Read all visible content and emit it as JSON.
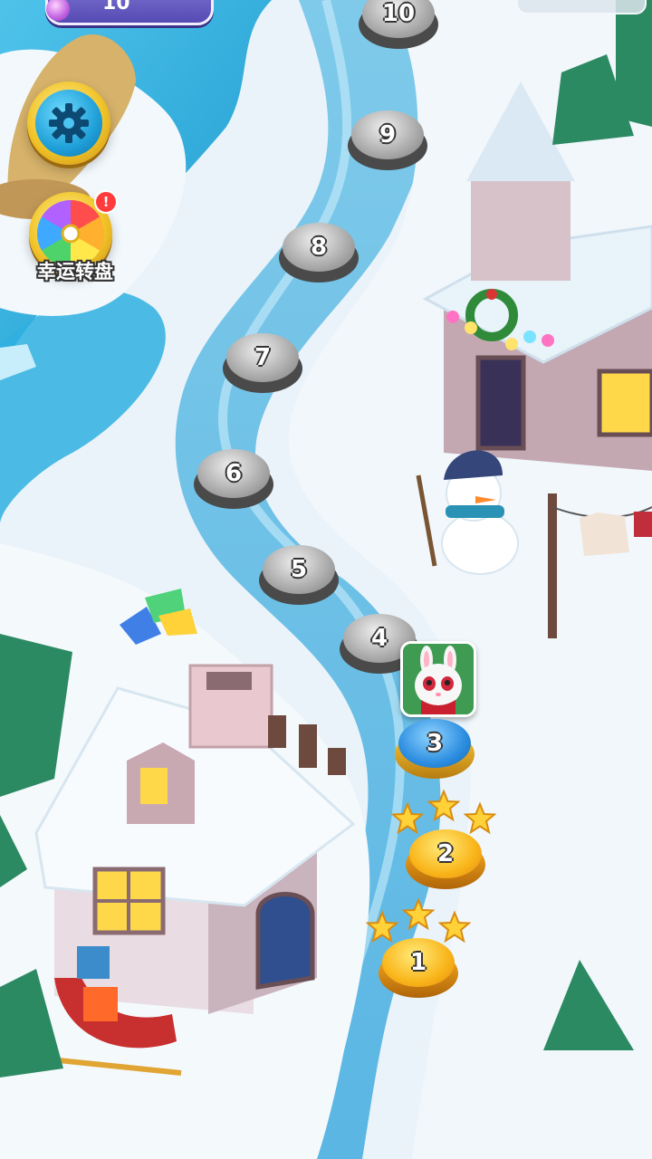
{
  "hud": {
    "gem_count": "10"
  },
  "side_buttons": {
    "wheel_label": "幸运转盘",
    "wheel_badge": "!"
  },
  "levels": [
    {
      "number": "1",
      "state": "done",
      "stars": 3
    },
    {
      "number": "2",
      "state": "done",
      "stars": 3
    },
    {
      "number": "3",
      "state": "current"
    },
    {
      "number": "4",
      "state": "locked"
    },
    {
      "number": "5",
      "state": "locked"
    },
    {
      "number": "6",
      "state": "locked"
    },
    {
      "number": "7",
      "state": "locked"
    },
    {
      "number": "8",
      "state": "locked"
    },
    {
      "number": "9",
      "state": "locked"
    },
    {
      "number": "10",
      "state": "locked"
    }
  ],
  "colors": {
    "river": "#8fd3ee",
    "river_deep": "#29a8d8",
    "snow": "#f1f7fb",
    "gold": "#f9b51a",
    "current_blue": "#2d8ee0"
  },
  "icons": {
    "settings": "gear-icon",
    "wheel": "lucky-wheel-icon",
    "avatar": "bunny-avatar-icon"
  }
}
